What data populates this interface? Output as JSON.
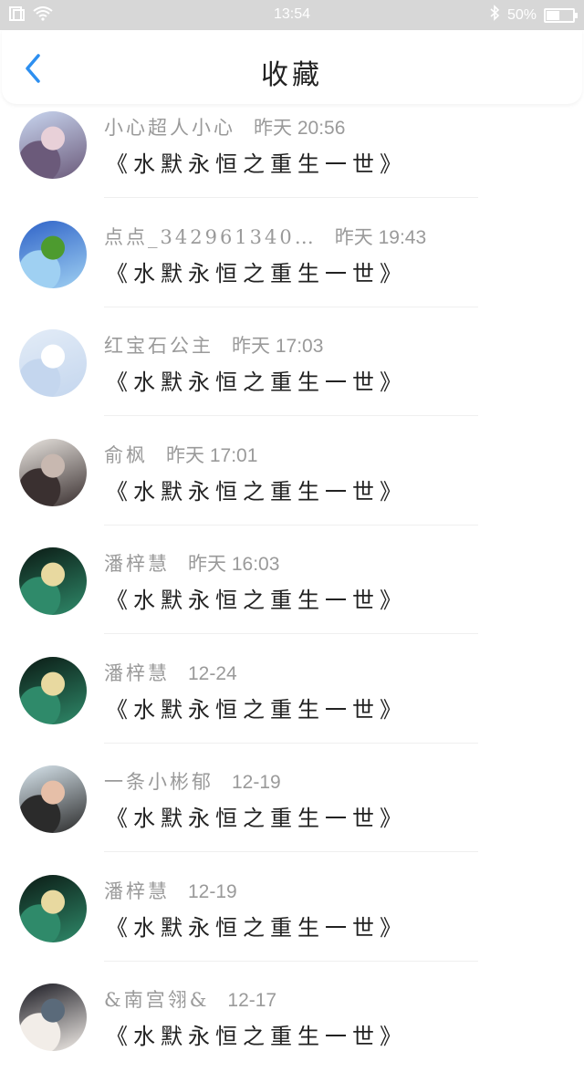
{
  "status_bar": {
    "time": "13:54",
    "battery": "50%",
    "battery_level": 0.5
  },
  "header": {
    "title": "收藏"
  },
  "items": [
    {
      "name": "小心超人小心",
      "time": "昨天 20:56",
      "book": "《水默永恒之重生一世》",
      "avatar_colors": [
        "#c9d6f0",
        "#6b5a7a",
        "#e8d0d8"
      ]
    },
    {
      "name": "点点_342961340…",
      "time": "昨天 19:43",
      "book": "《水默永恒之重生一世》",
      "avatar_colors": [
        "#2f63c8",
        "#9fd0f2",
        "#4d9b2f"
      ]
    },
    {
      "name": "红宝石公主",
      "time": "昨天 17:03",
      "book": "《水默永恒之重生一世》",
      "avatar_colors": [
        "#e3ecf7",
        "#c4d6ee",
        "#ffffff"
      ]
    },
    {
      "name": "俞枫",
      "time": "昨天 17:01",
      "book": "《水默永恒之重生一世》",
      "avatar_colors": [
        "#e8e4df",
        "#3a3030",
        "#c8b8b0"
      ]
    },
    {
      "name": "潘梓慧",
      "time": "昨天 16:03",
      "book": "《水默永恒之重生一世》",
      "avatar_colors": [
        "#0b1a14",
        "#2f8a6a",
        "#e8d9a0"
      ]
    },
    {
      "name": "潘梓慧",
      "time": "12-24",
      "book": "《水默永恒之重生一世》",
      "avatar_colors": [
        "#0b1a14",
        "#2f8a6a",
        "#e8d9a0"
      ]
    },
    {
      "name": "一条小彬郁",
      "time": "12-19",
      "book": "《水默永恒之重生一世》",
      "avatar_colors": [
        "#d9e6ee",
        "#2b2b2b",
        "#e6bfa8"
      ]
    },
    {
      "name": "潘梓慧",
      "time": "12-19",
      "book": "《水默永恒之重生一世》",
      "avatar_colors": [
        "#0b1a14",
        "#2f8a6a",
        "#e8d9a0"
      ]
    },
    {
      "name": "&南宫翎&",
      "time": "12-17",
      "book": "《水默永恒之重生一世》",
      "avatar_colors": [
        "#1a1a22",
        "#f2ede8",
        "#5a6a7a"
      ]
    }
  ]
}
